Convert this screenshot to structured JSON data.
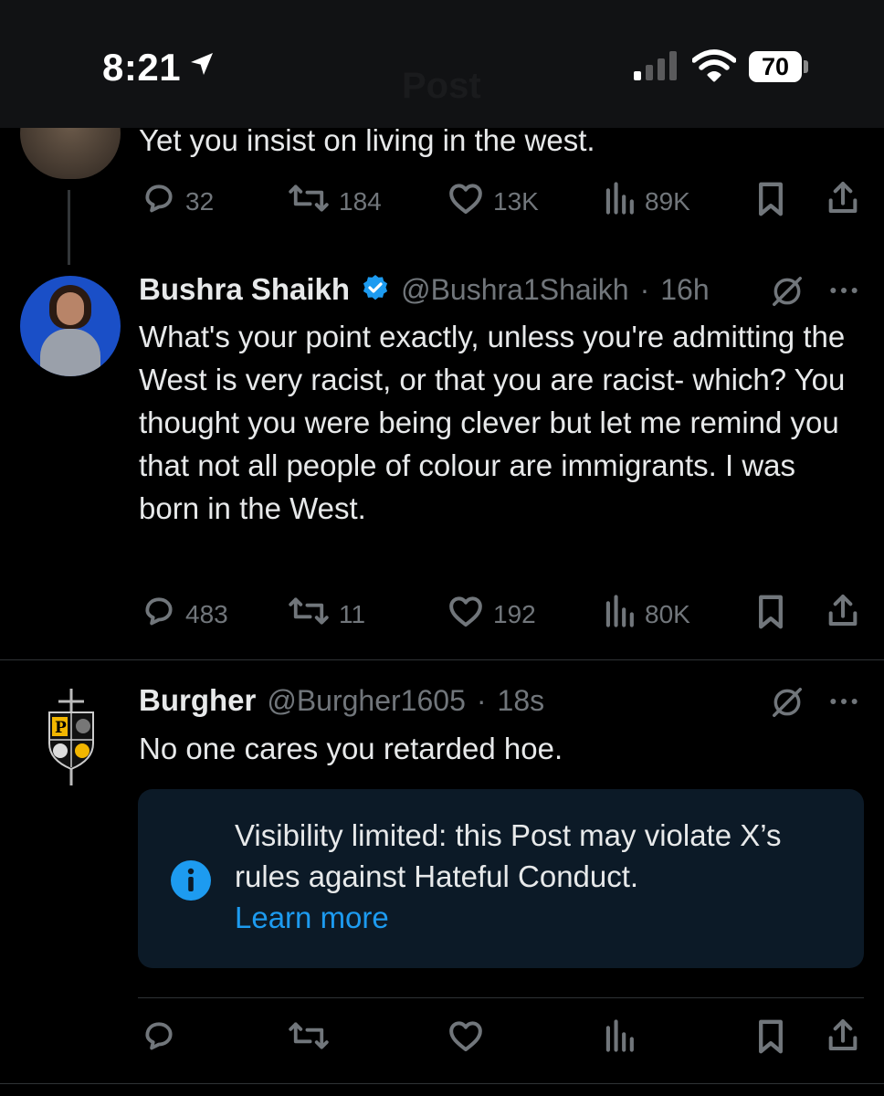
{
  "status_bar": {
    "time": "8:21",
    "battery": "70",
    "header_title_ghost": "Post"
  },
  "top_post": {
    "text_fragment": "Yet you insist on living in the west.",
    "replies": "32",
    "reposts": "184",
    "likes": "13K",
    "views": "89K"
  },
  "reply_post": {
    "display_name": "Bushra Shaikh",
    "verified": true,
    "handle": "@Bushra1Shaikh",
    "time": "16h",
    "text": "What's your point exactly, unless you're admitting the West is very racist, or that you are racist- which? You thought you were being clever but let me remind you that not all people of colour are immigrants. I was born in the West.",
    "replies": "483",
    "reposts": "11",
    "likes": "192",
    "views": "80K"
  },
  "limited_post": {
    "display_name": "Burgher",
    "handle": "@Burgher1605",
    "time": "18s",
    "text": "No one cares you retarded hoe.",
    "notice_text": "Visibility limited: this Post may violate X’s rules against Hateful Conduct.",
    "notice_link": "Learn more"
  },
  "colors": {
    "background": "#000000",
    "text": "#e7e9ea",
    "muted": "#71767b",
    "accent": "#1d9bf0",
    "notice_bg": "#0c1a27",
    "divider": "#2f3336"
  },
  "icons": [
    "location-arrow-icon",
    "signal-icon",
    "wifi-icon",
    "battery-icon",
    "reply-icon",
    "repost-icon",
    "like-icon",
    "views-icon",
    "bookmark-icon",
    "share-icon",
    "verified-badge-icon",
    "grok-icon",
    "more-icon",
    "info-icon"
  ]
}
